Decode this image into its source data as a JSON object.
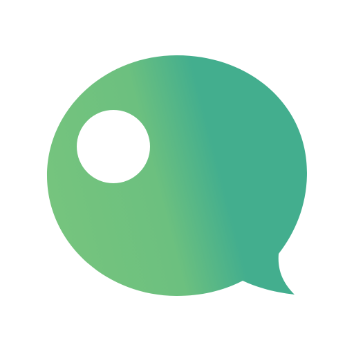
{
  "logo": {
    "icon": "chat-bubble-icon",
    "colors": {
      "gradient_start": "#76C47E",
      "gradient_mid": "#6CC07F",
      "gradient_end": "#43AE8E",
      "eye": "#ffffff",
      "background": "#ffffff"
    }
  }
}
